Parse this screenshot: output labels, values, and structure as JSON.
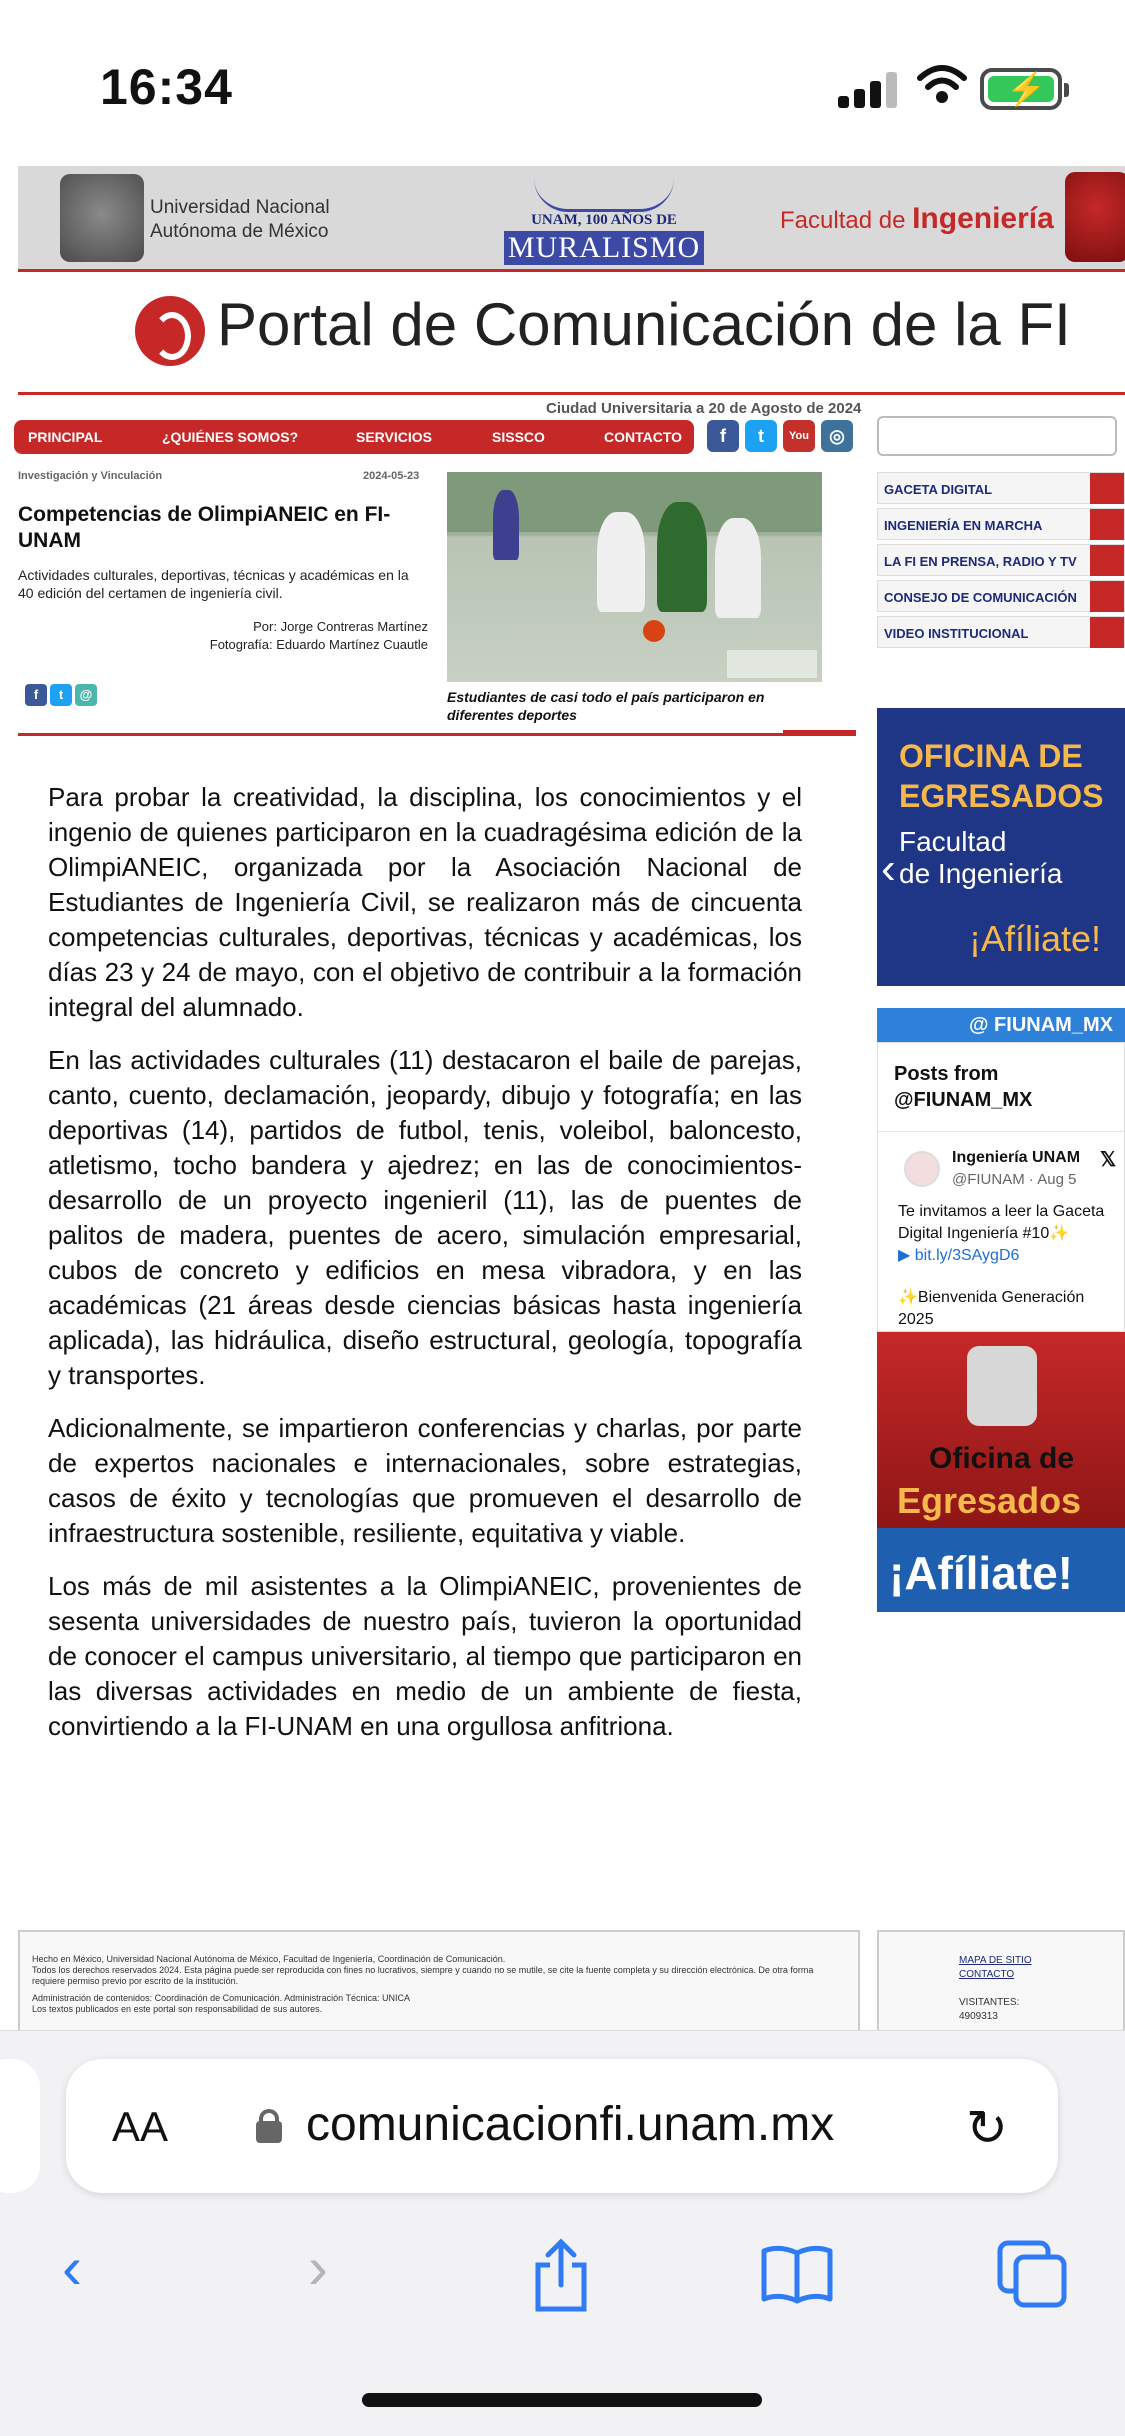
{
  "status": {
    "time": "16:34"
  },
  "banner": {
    "unam_name_1": "Universidad Nacional",
    "unam_name_2": "Autónoma de México",
    "mural_top": "UNAM, 100 AÑOS DE",
    "mural_big": "MURALISMO",
    "faculty_prefix": "Facultad de ",
    "faculty_name": "Ingeniería"
  },
  "portal_title": "Portal de Comunicación de la FI",
  "date_line": "Ciudad Universitaria a 20 de Agosto de 2024",
  "nav": {
    "items": [
      "PRINCIPAL",
      "¿QUIÉNES SOMOS?",
      "SERVICIOS",
      "SISSCO",
      "CONTACTO"
    ]
  },
  "social": {
    "facebook": "f",
    "twitter": "t",
    "youtube": "You",
    "instagram": "◎"
  },
  "sidebar_links": [
    "GACETA DIGITAL",
    "INGENIERÍA EN MARCHA",
    "LA FI EN PRENSA, RADIO Y TV",
    "CONSEJO DE COMUNICACIÓN",
    "VIDEO INSTITUCIONAL"
  ],
  "article": {
    "category": "Investigación y Vinculación",
    "date": "2024-05-23",
    "headline": "Competencias de OlimpiANEIC en FI-UNAM",
    "summary": "Actividades culturales, deportivas, técnicas y académicas en la 40 edición del certamen de ingeniería civil.",
    "author": "Por: Jorge Contreras Martínez",
    "photo_credit": "Fotografía: Eduardo Martínez Cuautle",
    "caption": "Estudiantes de casi todo el país participaron en diferentes deportes",
    "paragraphs": [
      "Para probar la creatividad, la disciplina, los conocimientos y el ingenio de quienes participaron en la cuadragésima edición de la OlimpiANEIC, organizada por la Asociación Nacional de Estudiantes de Ingeniería Civil, se realizaron más de cincuenta competencias culturales, deportivas, técnicas y académicas, los días 23 y 24 de mayo, con el objetivo de contribuir a la formación integral del alumnado.",
      "En las actividades culturales (11) destacaron el baile de parejas, canto, cuento, declamación, jeopardy, dibujo y fotografía; en las deportivas (14), partidos de futbol, tenis, voleibol, baloncesto, atletismo, tocho bandera y ajedrez; en las de conocimientos-desarrollo de un proyecto ingenieril (11), las de puentes de palitos de madera, puentes de acero, simulación empresarial, cubos de concreto y edificios en mesa vibradora, y en las académicas (21 áreas desde ciencias básicas hasta ingeniería aplicada), las hidráulica, diseño estructural, geología, topografía y transportes.",
      "Adicionalmente, se impartieron conferencias y charlas, por parte de expertos nacionales e internacionales, sobre estrategias, casos de éxito y tecnologías que promueven el desarrollo de infraestructura sostenible, resiliente, equitativa y viable.",
      "Los más de mil asistentes a la OlimpiANEIC, provenientes de sesenta universidades de nuestro país, tuvieron la oportunidad de conocer el campus universitario, al tiempo que participaron en las diversas actividades en medio de un ambiente de fiesta, convirtiendo a la FI-UNAM en una orgullosa anfitriona."
    ]
  },
  "egresados_ad": {
    "line1": "OFICINA DE",
    "line2": "EGRESADOS",
    "line3": "Facultad",
    "line4": "de Ingeniería",
    "cta": "¡Afíliate!"
  },
  "twitter": {
    "header": "@ FIUNAM_MX",
    "title": "Posts from @FIUNAM_MX",
    "name": "Ingeniería UNAM",
    "handle": "@FIUNAM · Aug 5",
    "text": "Te invitamos a leer la Gaceta Digital Ingeniería #10✨",
    "link": "▶ bit.ly/3SAygD6",
    "text2": "✨Bienvenida Generación 2025"
  },
  "oficina_ad": {
    "line1": "Oficina de",
    "line2": "Egresados",
    "cta": "¡Afíliate!"
  },
  "footer": {
    "line1": "Hecho en México, Universidad Nacional Autónoma de México, Facultad de Ingeniería, Coordinación de Comunicación.",
    "line2": "Todos los derechos reservados 2024. Esta página puede ser reproducida con fines no lucrativos, siempre y cuando no se mutile, se cite la fuente completa y su dirección electrónica. De otra forma requiere permiso previo por escrito de la institución.",
    "line3": "Administración de contenidos: Coordinación de Comunicación. Administración Técnica: UNICA",
    "line4": "Los textos publicados en este portal son responsabilidad de sus autores.",
    "sitemap": "MAPA DE SITIO",
    "contact": "CONTACTO",
    "visitors": "VISITANTES: 4909313"
  },
  "browser": {
    "aa": "AA",
    "url": "comunicacionfi.unam.mx"
  }
}
